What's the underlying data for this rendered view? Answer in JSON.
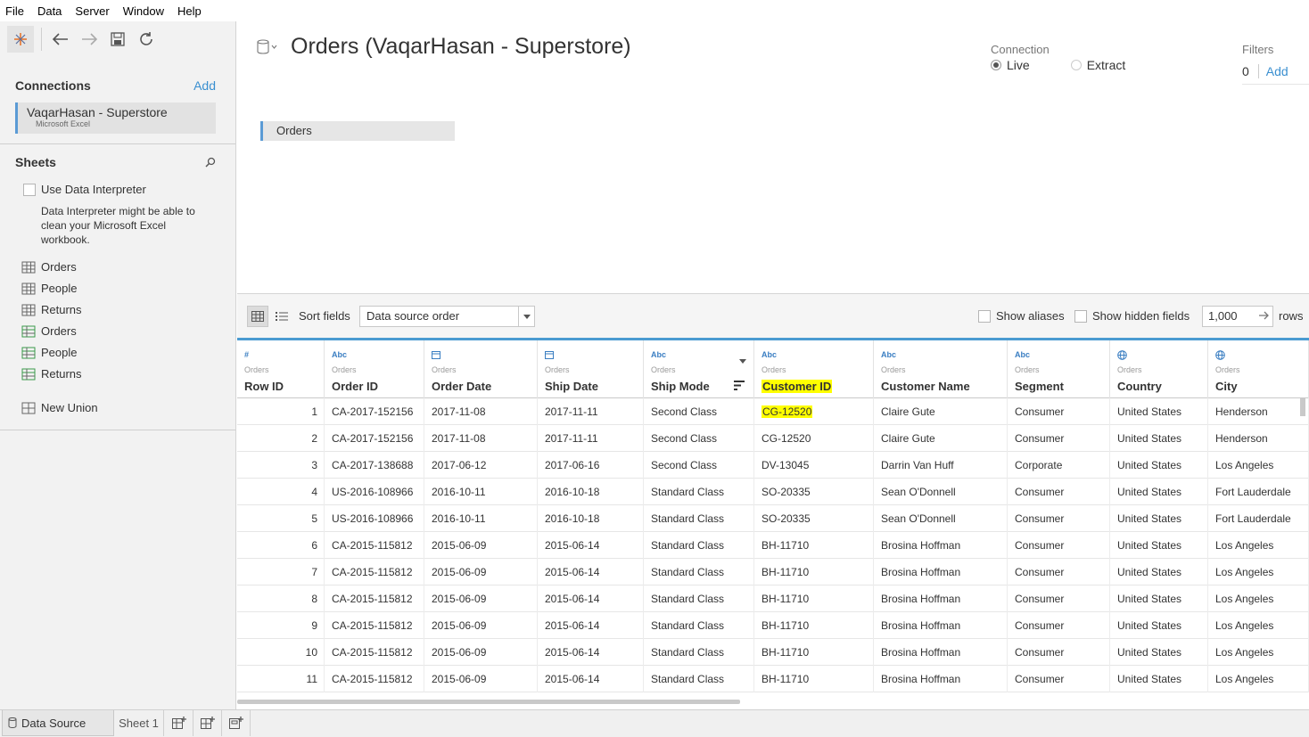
{
  "menu": [
    "File",
    "Data",
    "Server",
    "Window",
    "Help"
  ],
  "left": {
    "connections_title": "Connections",
    "add_label": "Add",
    "connection": {
      "name": "VaqarHasan - Superstore",
      "type": "Microsoft Excel"
    },
    "sheets_title": "Sheets",
    "interpreter_label": "Use Data Interpreter",
    "interpreter_note": "Data Interpreter might be able to clean your Microsoft Excel workbook.",
    "sheets": [
      {
        "label": "Orders",
        "icon": "table-icon"
      },
      {
        "label": "People",
        "icon": "table-icon"
      },
      {
        "label": "Returns",
        "icon": "table-icon"
      },
      {
        "label": "Orders",
        "icon": "named-range-icon"
      },
      {
        "label": "People",
        "icon": "named-range-icon"
      },
      {
        "label": "Returns",
        "icon": "named-range-icon"
      }
    ],
    "new_union": "New Union"
  },
  "canvas": {
    "title": "Orders (VaqarHasan - Superstore)",
    "connection_label": "Connection",
    "live_label": "Live",
    "extract_label": "Extract",
    "connection_selected": "Live",
    "filters_label": "Filters",
    "filters_count": "0",
    "filters_add": "Add",
    "table_chip": "Orders"
  },
  "gridbar": {
    "sort_label": "Sort fields",
    "sort_value": "Data source order",
    "show_aliases": "Show aliases",
    "show_hidden": "Show hidden fields",
    "rows_value": "1,000",
    "rows_label": "rows"
  },
  "columns": [
    {
      "type": "#",
      "source": "Orders",
      "name": "Row ID"
    },
    {
      "type": "Abc",
      "source": "Orders",
      "name": "Order ID"
    },
    {
      "type": "date",
      "source": "Orders",
      "name": "Order Date"
    },
    {
      "type": "date",
      "source": "Orders",
      "name": "Ship Date"
    },
    {
      "type": "Abc",
      "source": "Orders",
      "name": "Ship Mode"
    },
    {
      "type": "Abc",
      "source": "Orders",
      "name": "Customer ID"
    },
    {
      "type": "Abc",
      "source": "Orders",
      "name": "Customer Name"
    },
    {
      "type": "Abc",
      "source": "Orders",
      "name": "Segment"
    },
    {
      "type": "geo",
      "source": "Orders",
      "name": "Country"
    },
    {
      "type": "geo",
      "source": "Orders",
      "name": "City"
    }
  ],
  "rows": [
    [
      "1",
      "CA-2017-152156",
      "2017-11-08",
      "2017-11-11",
      "Second Class",
      "CG-12520",
      "Claire Gute",
      "Consumer",
      "United States",
      "Henderson"
    ],
    [
      "2",
      "CA-2017-152156",
      "2017-11-08",
      "2017-11-11",
      "Second Class",
      "CG-12520",
      "Claire Gute",
      "Consumer",
      "United States",
      "Henderson"
    ],
    [
      "3",
      "CA-2017-138688",
      "2017-06-12",
      "2017-06-16",
      "Second Class",
      "DV-13045",
      "Darrin Van Huff",
      "Corporate",
      "United States",
      "Los Angeles"
    ],
    [
      "4",
      "US-2016-108966",
      "2016-10-11",
      "2016-10-18",
      "Standard Class",
      "SO-20335",
      "Sean O'Donnell",
      "Consumer",
      "United States",
      "Fort Lauderdale"
    ],
    [
      "5",
      "US-2016-108966",
      "2016-10-11",
      "2016-10-18",
      "Standard Class",
      "SO-20335",
      "Sean O'Donnell",
      "Consumer",
      "United States",
      "Fort Lauderdale"
    ],
    [
      "6",
      "CA-2015-115812",
      "2015-06-09",
      "2015-06-14",
      "Standard Class",
      "BH-11710",
      "Brosina Hoffman",
      "Consumer",
      "United States",
      "Los Angeles"
    ],
    [
      "7",
      "CA-2015-115812",
      "2015-06-09",
      "2015-06-14",
      "Standard Class",
      "BH-11710",
      "Brosina Hoffman",
      "Consumer",
      "United States",
      "Los Angeles"
    ],
    [
      "8",
      "CA-2015-115812",
      "2015-06-09",
      "2015-06-14",
      "Standard Class",
      "BH-11710",
      "Brosina Hoffman",
      "Consumer",
      "United States",
      "Los Angeles"
    ],
    [
      "9",
      "CA-2015-115812",
      "2015-06-09",
      "2015-06-14",
      "Standard Class",
      "BH-11710",
      "Brosina Hoffman",
      "Consumer",
      "United States",
      "Los Angeles"
    ],
    [
      "10",
      "CA-2015-115812",
      "2015-06-09",
      "2015-06-14",
      "Standard Class",
      "BH-11710",
      "Brosina Hoffman",
      "Consumer",
      "United States",
      "Los Angeles"
    ],
    [
      "11",
      "CA-2015-115812",
      "2015-06-09",
      "2015-06-14",
      "Standard Class",
      "BH-11710",
      "Brosina Hoffman",
      "Consumer",
      "United States",
      "Los Angeles"
    ]
  ],
  "highlight": {
    "column": "Customer ID",
    "row_index": 0,
    "color": "#ffff00"
  },
  "tabs": {
    "data_source": "Data Source",
    "sheet": "Sheet 1"
  },
  "colors": {
    "accent": "#4a9bd1",
    "link": "#3a8fd0"
  }
}
